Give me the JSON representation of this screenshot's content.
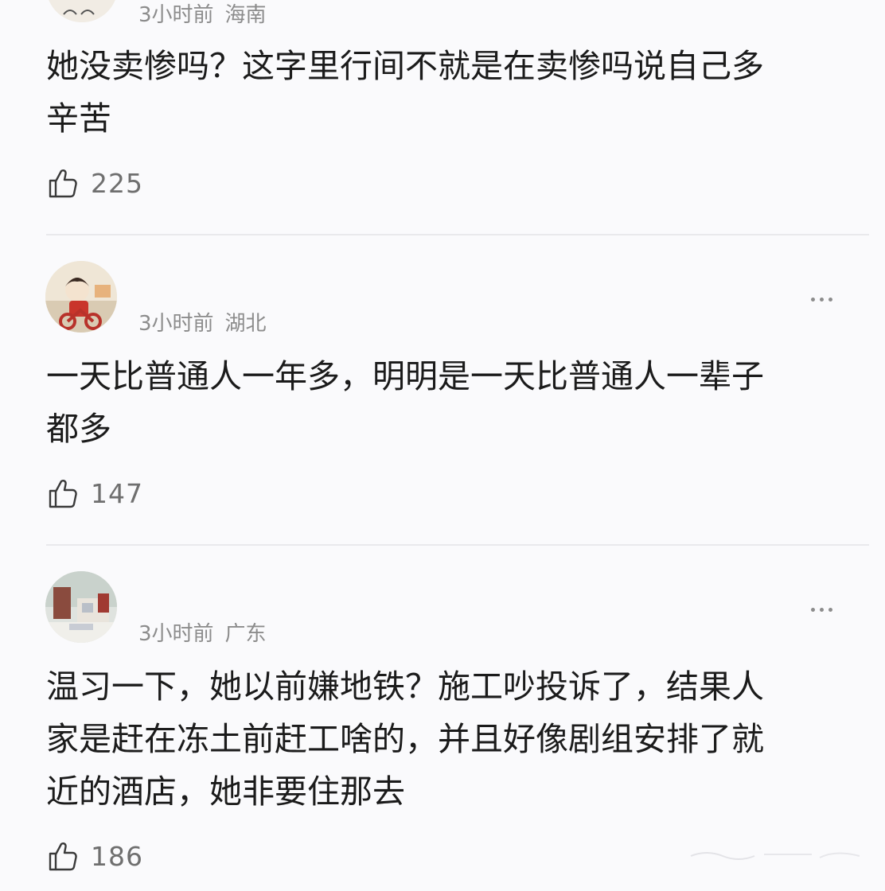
{
  "comments": [
    {
      "username": "",
      "time": "3小时前",
      "location": "海南",
      "lines": [
        "她没卖惨吗？这字里行间不就是在卖惨吗说自己多",
        "辛苦"
      ],
      "likes": "225"
    },
    {
      "username": "",
      "time": "3小时前",
      "location": "湖北",
      "lines": [
        "一天比普通人一年多，明明是一天比普通人一辈子",
        "都多"
      ],
      "likes": "147"
    },
    {
      "username": "",
      "time": "3小时前",
      "location": "广东",
      "lines": [
        "温习一下，她以前嫌地铁？施工吵投诉了，结果人",
        "家是赶在冻土前赶工啥的，并且好像剧组安排了就",
        "近的酒店，她非要住那去"
      ],
      "likes": "186"
    }
  ],
  "icons": {
    "like": "thumbs-up-icon",
    "more": "more-options-icon"
  },
  "colors": {
    "background": "#fafafc",
    "text": "#1b1b1b",
    "meta": "#8c8c8c",
    "divider": "#e9e9ec"
  }
}
